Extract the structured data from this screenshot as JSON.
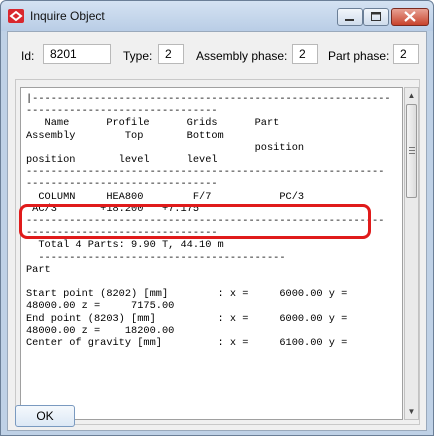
{
  "window": {
    "title": "Inquire Object"
  },
  "fields": {
    "id": {
      "label": "Id:",
      "value": "8201"
    },
    "type": {
      "label": "Type:",
      "value": "2"
    },
    "assembly_phase": {
      "label": "Assembly phase:",
      "value": "2"
    },
    "part_phase": {
      "label": "Part phase:",
      "value": "2"
    }
  },
  "report_lines": [
    "|----------------------------------------------------------",
    "-------------------------------",
    "   Name      Profile      Grids      Part",
    "Assembly        Top       Bottom",
    "                                     position",
    "position       level      level",
    "----------------------------------------------------------",
    "-------------------------------",
    "  COLUMN     HEA800        F/7           PC/3",
    " AC/3       +18.200   +7.175",
    "----------------------------------------------------------",
    "-------------------------------",
    "  Total 4 Parts: 9.90 T, 44.10 m",
    "  ----------------------------------------",
    "Part",
    "",
    "Start point (8202) [mm]        : x =     6000.00 y =",
    "48000.00 z =     7175.00",
    "End point (8203) [mm]          : x =     6000.00 y =",
    "48000.00 z =    18200.00",
    "Center of gravity [mm]         : x =     6100.00 y ="
  ],
  "buttons": {
    "ok": "OK"
  }
}
